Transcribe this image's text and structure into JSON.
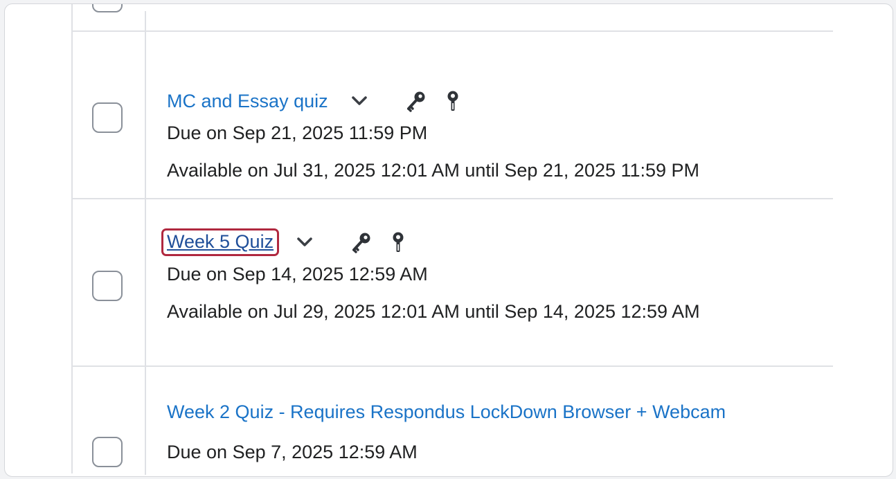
{
  "quizzes": [
    {
      "title": "MC and Essay quiz",
      "due": "Due on Sep 21, 2025 11:59 PM",
      "availability": "Available on Jul 31, 2025 12:01 AM until Sep 21, 2025 11:59 PM",
      "has_options_menu": true,
      "icons": [
        "key-icon",
        "pin-icon"
      ]
    },
    {
      "title": "Week 5 Quiz",
      "due": "Due on Sep 14, 2025 12:59 AM",
      "availability": "Available on Jul 29, 2025 12:01 AM until Sep 14, 2025 12:59 AM",
      "has_options_menu": true,
      "highlighted": true,
      "icons": [
        "key-icon",
        "pin-icon"
      ]
    },
    {
      "title": "Week 2 Quiz - Requires Respondus LockDown Browser + Webcam",
      "due": "Due on Sep 7, 2025 12:59 AM"
    }
  ],
  "colors": {
    "link": "#1a73c7",
    "link_visited": "#1f4e99",
    "highlight_border": "#b0283f",
    "text": "#202122",
    "divider": "#dfe1e5",
    "checkbox_border": "#8a9099"
  }
}
